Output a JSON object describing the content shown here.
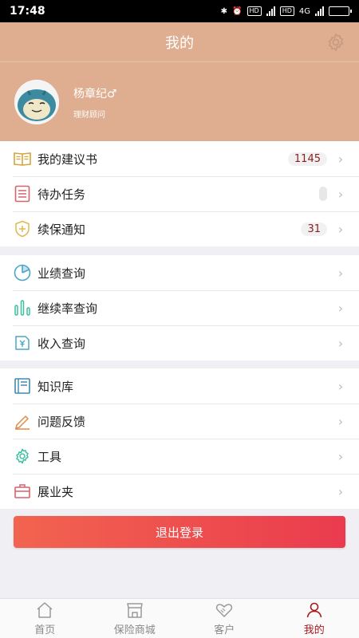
{
  "status": {
    "time": "17:48",
    "network": "4G",
    "hd": "HD"
  },
  "header": {
    "title": "我的"
  },
  "profile": {
    "name": "杨章纪♂",
    "role": "理财顾问"
  },
  "groups": [
    {
      "items": [
        {
          "label": "我的建议书",
          "icon": "book-icon",
          "badge": "1145"
        },
        {
          "label": "待办任务",
          "icon": "list-icon",
          "badge": ""
        },
        {
          "label": "续保通知",
          "icon": "shield-plus-icon",
          "badge": "31"
        }
      ]
    },
    {
      "items": [
        {
          "label": "业绩查询",
          "icon": "pie-chart-icon"
        },
        {
          "label": "继续率查询",
          "icon": "bar-chart-icon"
        },
        {
          "label": "收入查询",
          "icon": "income-icon"
        }
      ]
    },
    {
      "items": [
        {
          "label": "知识库",
          "icon": "knowledge-book-icon"
        },
        {
          "label": "问题反馈",
          "icon": "pencil-icon"
        },
        {
          "label": "工具",
          "icon": "gear-icon"
        },
        {
          "label": "展业夹",
          "icon": "briefcase-icon"
        }
      ]
    }
  ],
  "logout": {
    "label": "退出登录"
  },
  "tabs": [
    {
      "label": "首页",
      "icon": "home-icon"
    },
    {
      "label": "保险商城",
      "icon": "store-icon"
    },
    {
      "label": "客户",
      "icon": "handshake-icon"
    },
    {
      "label": "我的",
      "icon": "person-icon",
      "active": true
    }
  ],
  "colors": {
    "header": "#dfae91",
    "accent": "#a8171e",
    "logout_start": "#f2644f",
    "logout_end": "#ea3b4e"
  }
}
